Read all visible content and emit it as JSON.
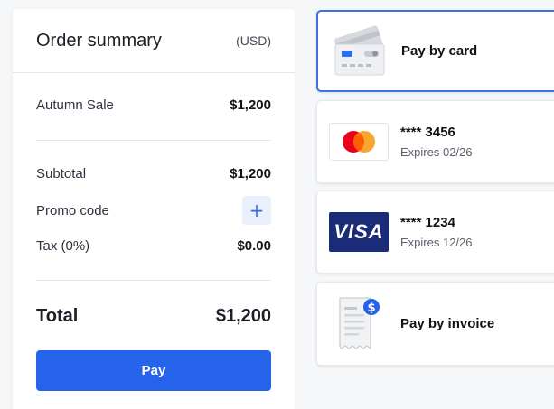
{
  "summary": {
    "title": "Order summary",
    "currency": "(USD)",
    "item": {
      "label": "Autumn Sale",
      "value": "$1,200"
    },
    "subtotal": {
      "label": "Subtotal",
      "value": "$1,200"
    },
    "promo": {
      "label": "Promo code",
      "button": "+"
    },
    "tax": {
      "label": "Tax (0%)",
      "value": "$0.00"
    },
    "total": {
      "label": "Total",
      "value": "$1,200"
    },
    "pay_label": "Pay"
  },
  "methods": {
    "card": {
      "label": "Pay by card"
    },
    "mastercard": {
      "number": "**** 3456",
      "expires": "Expires 02/26"
    },
    "visa": {
      "brand": "VISA",
      "number": "**** 1234",
      "expires": "Expires 12/26"
    },
    "invoice": {
      "label": "Pay by invoice"
    }
  },
  "colors": {
    "accent": "#2563eb",
    "selected_border": "#3a73e6",
    "visa_blue": "#1a2b78",
    "mastercard_red": "#eb001b",
    "mastercard_orange": "#f79e1b"
  }
}
